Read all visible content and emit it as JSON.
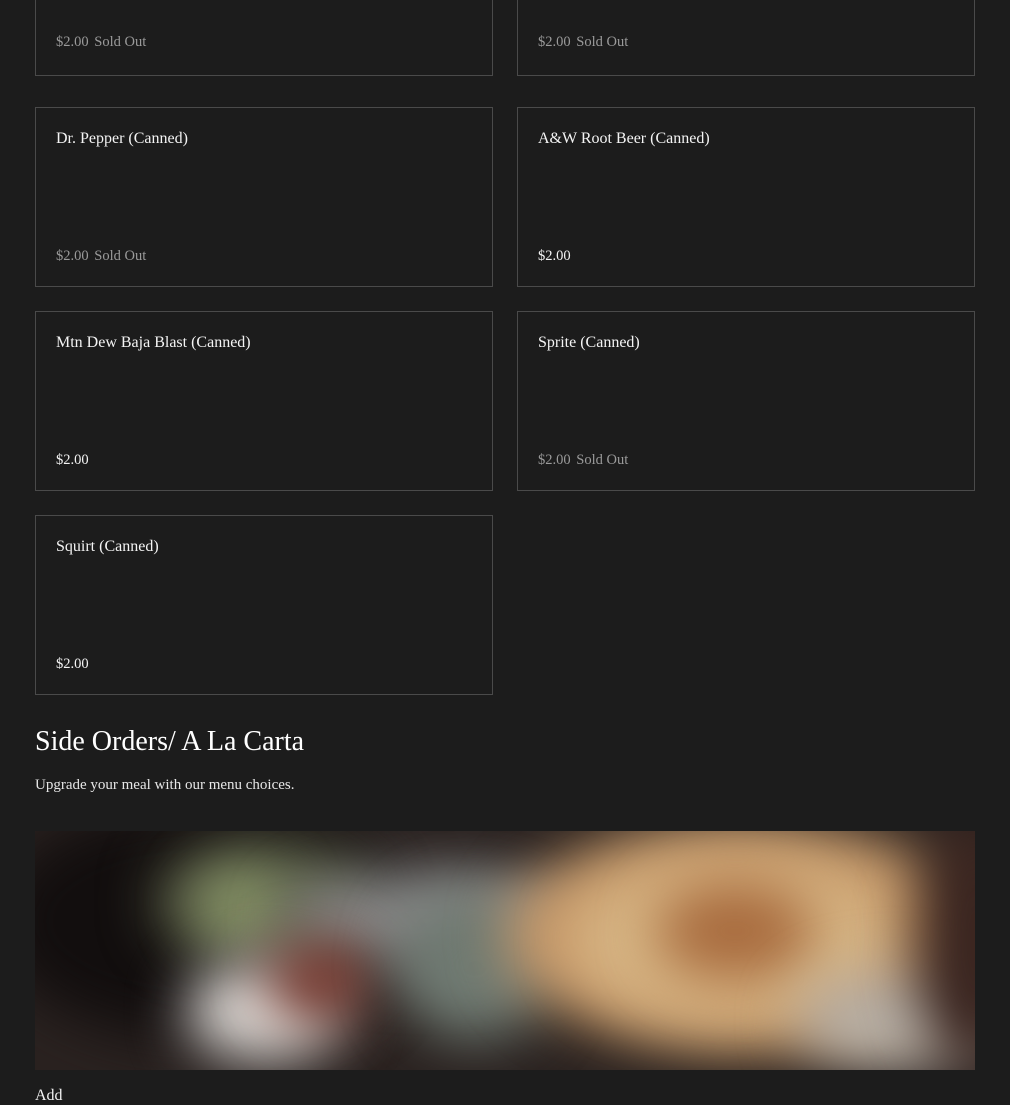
{
  "colors": {
    "background": "#1c1c1c",
    "card_border": "#4a4a4a",
    "text": "#f4f4f4",
    "muted_text": "#9a9a9a"
  },
  "drinks": {
    "top_left": {
      "price": "$2.00",
      "status": "Sold Out"
    },
    "top_right": {
      "price": "$2.00",
      "status": "Sold Out"
    },
    "items": [
      {
        "name": "Dr. Pepper (Canned)",
        "price": "$2.00",
        "status": "Sold Out"
      },
      {
        "name": "A&W Root Beer (Canned)",
        "price": "$2.00",
        "status": ""
      },
      {
        "name": "Mtn Dew Baja Blast (Canned)",
        "price": "$2.00",
        "status": ""
      },
      {
        "name": "Sprite (Canned)",
        "price": "$2.00",
        "status": "Sold Out"
      },
      {
        "name": "Squirt (Canned)",
        "price": "$2.00",
        "status": ""
      }
    ]
  },
  "side_orders": {
    "title": "Side Orders/ A La Carta",
    "description": "Upgrade your meal with our menu choices.",
    "image_icon": "food-photo",
    "first_item_partial": "Add"
  }
}
